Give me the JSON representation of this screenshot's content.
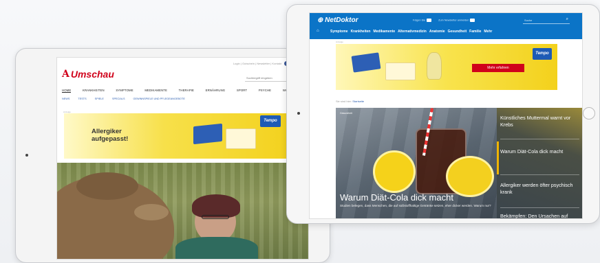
{
  "umschau": {
    "topline": "Login | Gutschein | Newsletter | Kontakt",
    "logo_mark": "A",
    "logo_text": "Umschau",
    "search_placeholder": "Suchbegriff eingeben",
    "nav": [
      "HOME",
      "KRANKHEITEN",
      "SYMPTOME",
      "MEDIKAMENTE",
      "THERAPIE",
      "ERNÄHRUNG",
      "SPORT",
      "PSYCHE",
      "WOHLFÜHLEN"
    ],
    "subnav": [
      "NEWS",
      "TESTS",
      "SPIELE",
      "SPECIALS",
      "GEWINNSPIELE UND PFLEGEANGEBOTE"
    ],
    "ad_label": "Anzeige",
    "ad_headline_1": "Allergiker",
    "ad_headline_2": "aufgepasst!",
    "ad_brand": "Tempo"
  },
  "netdoktor": {
    "logo_net": "NetDoktor",
    "logo_mark": "⊕",
    "meta_facebook": "Folgen Sie",
    "meta_newsletter": "Zum Newsletter anmelden",
    "search_placeholder": "Suche",
    "nav": [
      "Symptome",
      "Krankheiten",
      "Medikamente",
      "Alternativmedizin",
      "Anatomie",
      "Gesundheit",
      "Familie",
      "Mehr"
    ],
    "ad_label": "Anzeige",
    "ad_brand": "Tempo",
    "ad_cta": "Mehr erfahren",
    "breadcrumb_prefix": "Sie sind hier:",
    "breadcrumb_link": "Startseite",
    "hero_label": "Gesundheit",
    "hero_title": "Warum Diät-Cola dick macht",
    "hero_teaser": "Studien belegen, dass Menschen, die auf süßstoffhaltige Getränke setzen, eher dicker werden. Warum nur?",
    "side_items": [
      "Künstliches Muttermal warnt vor Krebs",
      "Warum Diät-Cola dick macht",
      "Allergiker werden öfter psychisch krank",
      "Bekämpfen: Den Ursachen auf"
    ]
  },
  "colors": {
    "umschau_red": "#d0021b",
    "netdoktor_blue": "#0b74c7",
    "tempo_blue": "#1e5bb5"
  }
}
